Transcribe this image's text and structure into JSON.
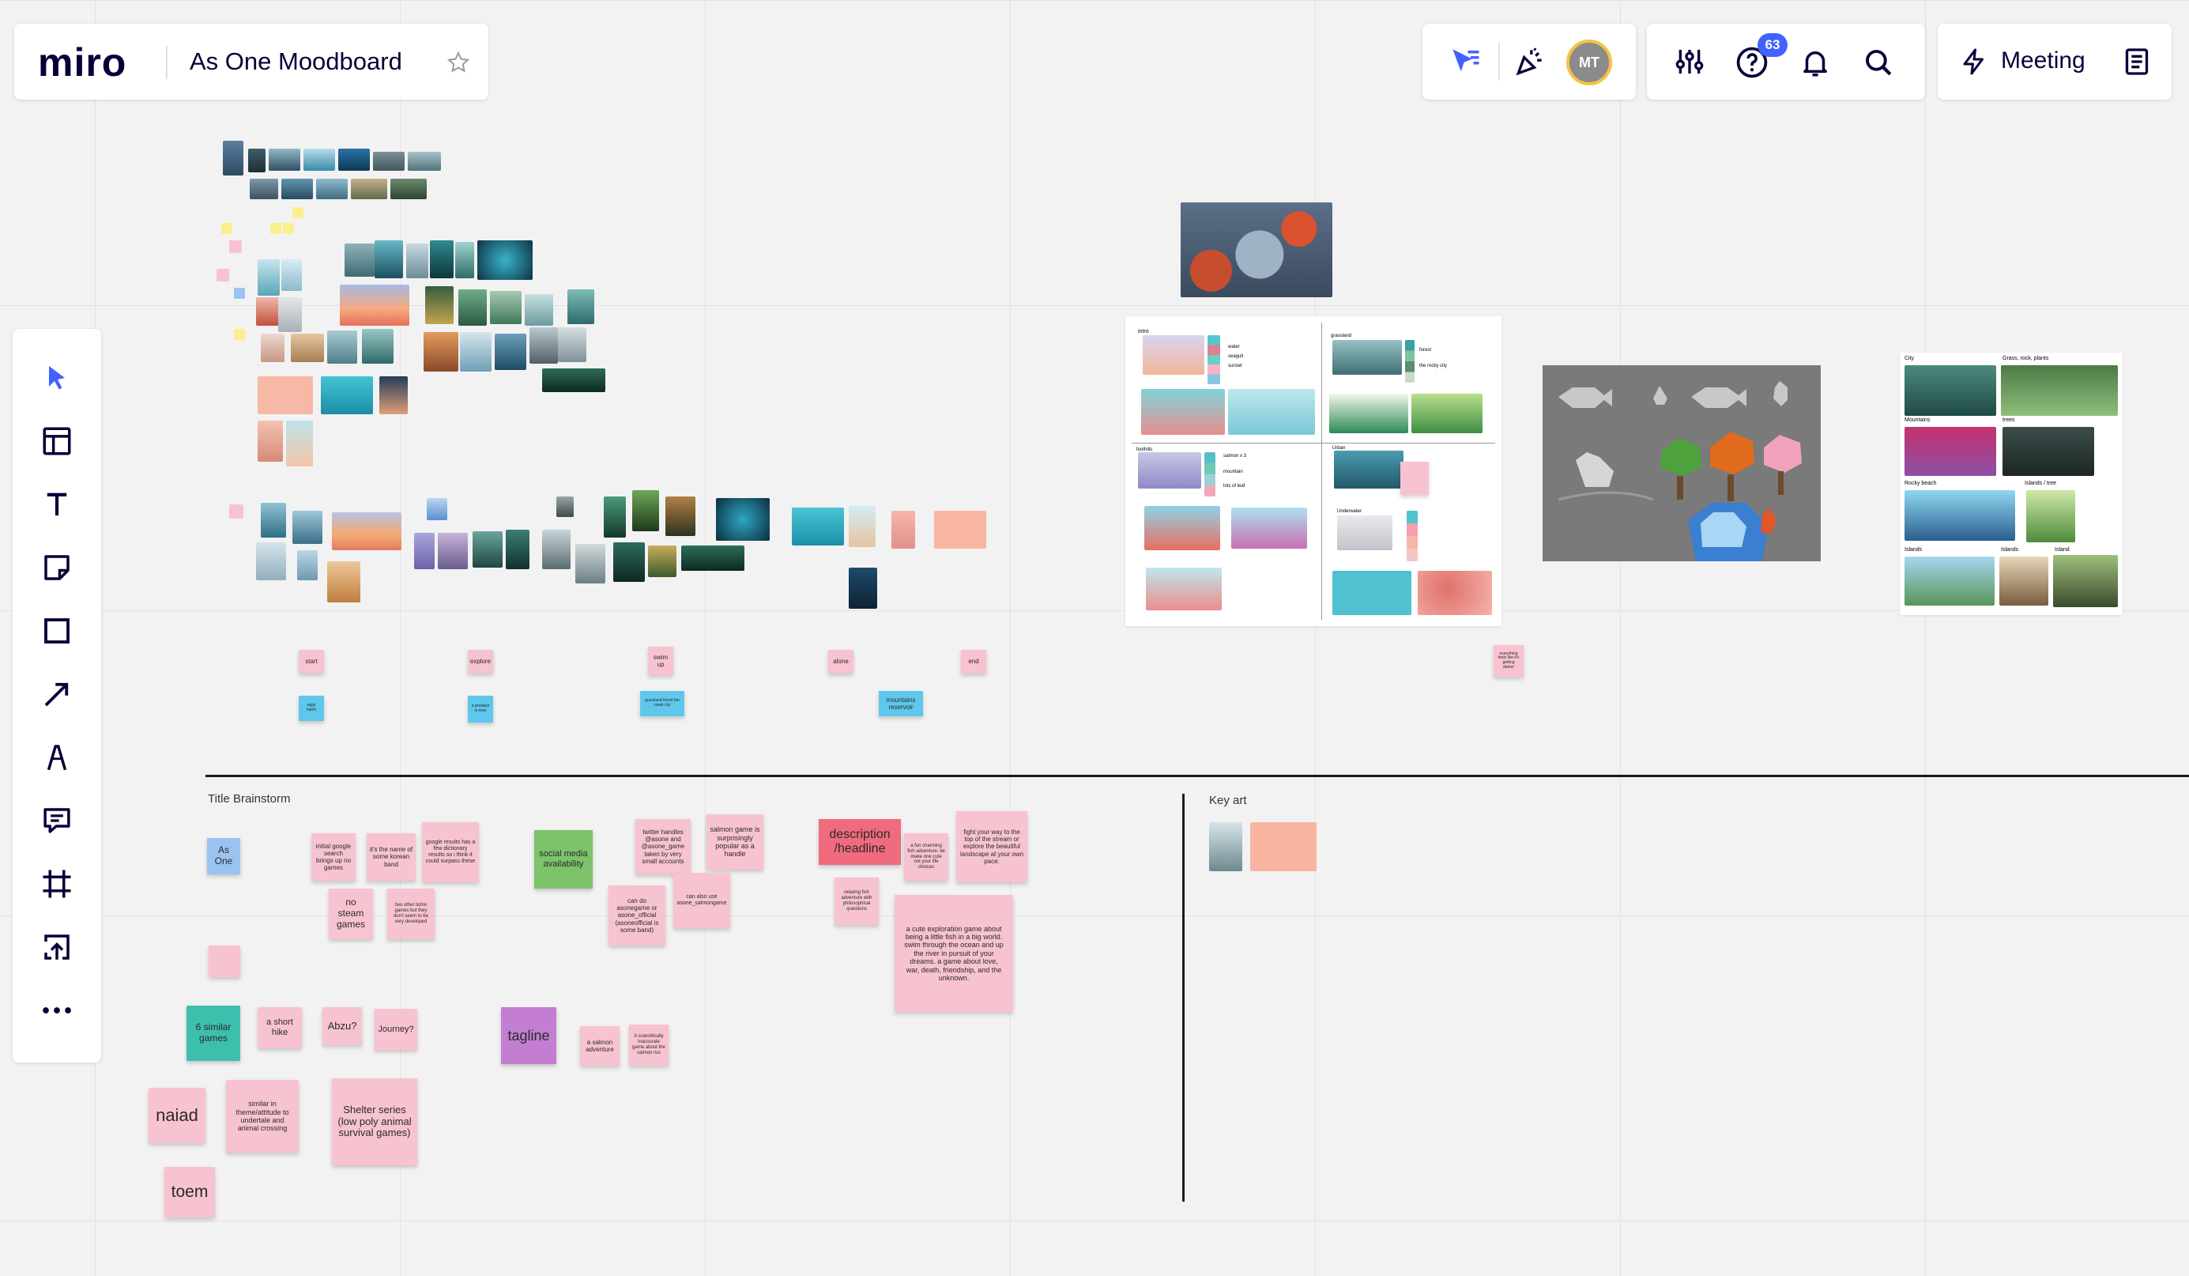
{
  "app": {
    "logo": "miro",
    "board_title": "As One Moodboard"
  },
  "header": {
    "notification_count": "63",
    "avatar_initials": "MT",
    "meeting_label": "Meeting"
  },
  "colors": {
    "accent": "#4262ff",
    "avatar_ring": "#f6c244",
    "avatar_bg": "#8b8b8b",
    "badge": "#4262ff"
  },
  "toolbar": {
    "tools": [
      "select-cursor-icon",
      "templates-icon",
      "text-icon",
      "sticky-note-icon",
      "shape-icon",
      "arrow-icon",
      "pen-icon",
      "comment-icon",
      "frame-icon",
      "upload-icon",
      "more-icon"
    ]
  },
  "flow_notes": {
    "start": "start",
    "explore": "explore",
    "swim_up": "swim up",
    "alone": "alone",
    "end": "end",
    "under_1": "eggs hatch",
    "under_2": "a predator is near",
    "under_3": "grassland forest fan creek city",
    "under_4": "mountains reservoir",
    "far_right": "everything feels like it's getting darker"
  },
  "frames": {
    "title_brainstorm": "Title Brainstorm",
    "key_art": "Key art"
  },
  "brainstorm": {
    "as_one": "As One",
    "google_search": "initial google search brings up no games",
    "korean_band": "it's the name of some korean band",
    "google_results": "google results has a few dictionary results so i think it could surpass these",
    "no_steam": "no steam games",
    "two_other": "two other itchio games but they don't seem to be very developed",
    "social_media": "social media availability",
    "twitter": "twitter handles @asone and @asone_game taken by very small accounts",
    "salmon_popular": "salmon game is surprisingly popular as a handle",
    "asonegame": "can do asonegame or asone_official (asoneofficial is some band)",
    "can_also_use": "can also use asone_salmongame",
    "description": "description /headline",
    "charming": "a fun charming fish adventure. let make one cute not your life choices",
    "relaxing": "relaxing fish adventure with philosophical questions",
    "fight_your_way": "fight your way to the top of the stream or explore the beautiful landscape at your own pace.",
    "cute_exploration": "a cute exploration game about being a little fish in a big world. swim through the ocean and up the river in pursuit of your dreams. a game about love, war, death, friendship, and the unknown.",
    "six_similar": "6 similar games",
    "short_hike": "a short hike",
    "abzu": "Abzu?",
    "journey": "Journey?",
    "tagline": "tagline",
    "salmon_adventure": "a salmon adventure",
    "scientifically": "A scientifically inaccurate game about the salmon run",
    "naiad": "naiad",
    "similar_theme": "similar in theme/attitude to undertale and animal crossing",
    "shelter": "Shelter series (low poly animal survival games)",
    "toem": "toem"
  },
  "sketch_sheet": {
    "labels": [
      "intro",
      "grassland",
      "forest",
      "the rocky city",
      "water",
      "seagull",
      "sunset",
      "foothills",
      "salmon x 3",
      "mountain",
      "lots of leaf",
      "Urban",
      "Underwater",
      "mountain river"
    ]
  },
  "reference_sheet": {
    "labels": [
      "City",
      "Grass, rock, plants",
      "Mountains",
      "trees",
      "Rocky beach",
      "Islands / tree",
      "Islands",
      "Islands",
      "Island"
    ]
  }
}
